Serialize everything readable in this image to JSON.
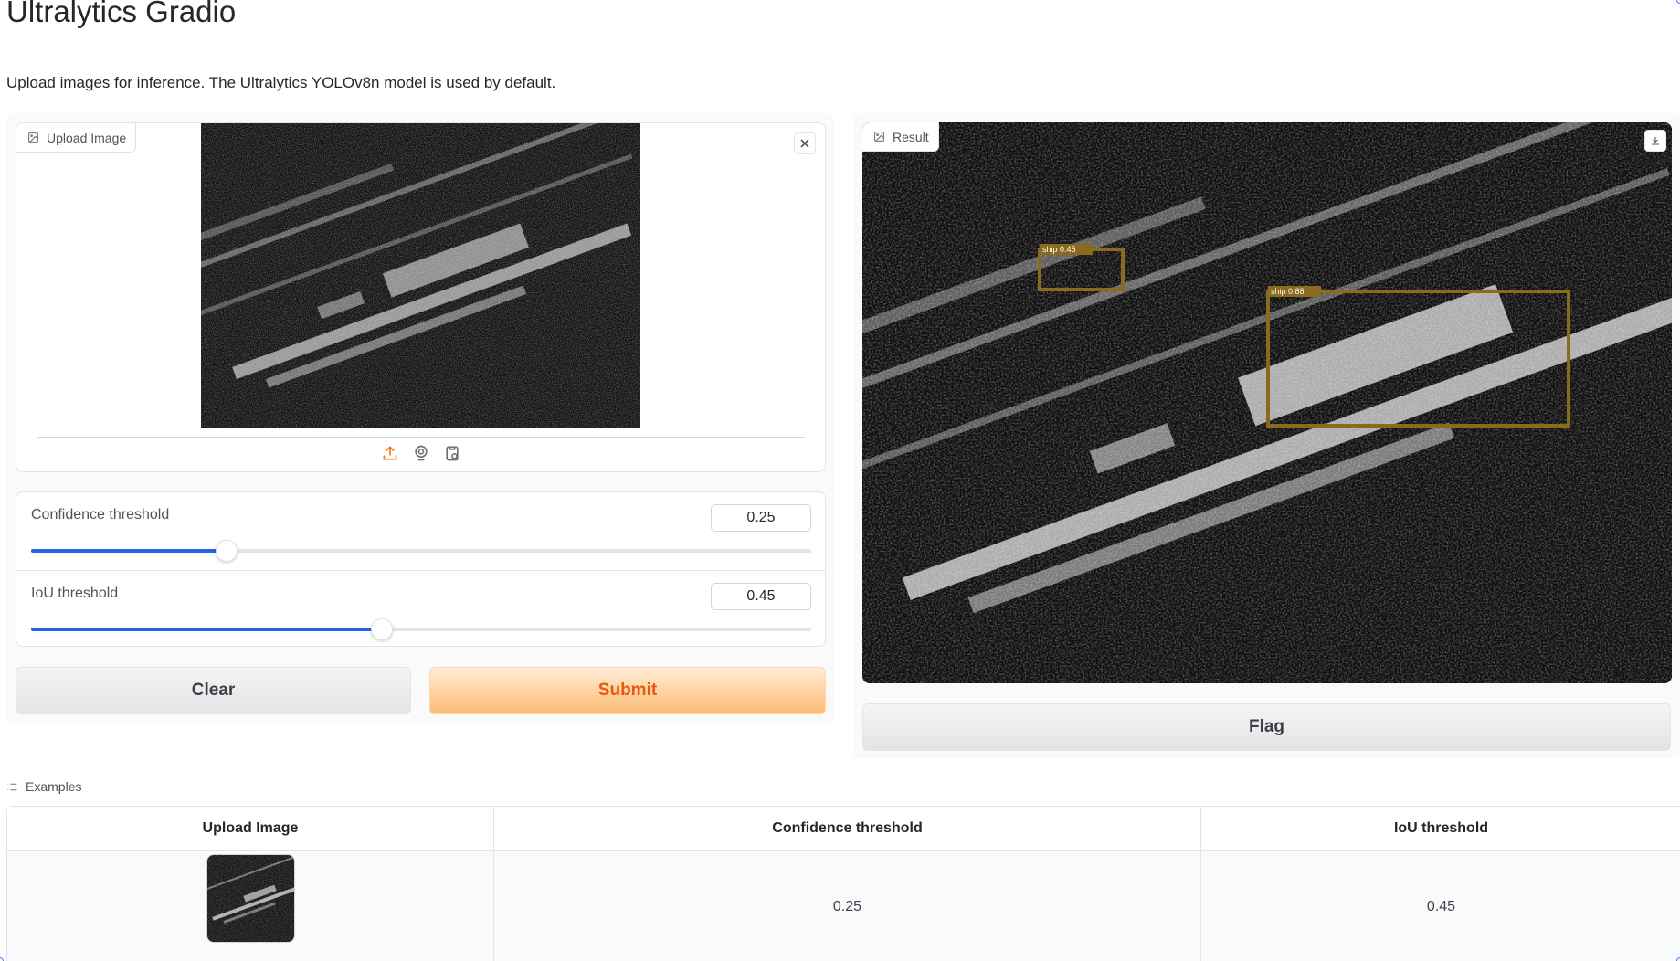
{
  "title": "Ultralytics Gradio",
  "description": "Upload images for inference. The Ultralytics YOLOv8n model is used by default.",
  "input_image": {
    "label": "Upload Image",
    "icon": "image-icon"
  },
  "source_icons": [
    "upload-icon",
    "webcam-icon",
    "clipboard-icon"
  ],
  "sliders": [
    {
      "label": "Confidence threshold",
      "value": "0.25",
      "fraction": 0.25
    },
    {
      "label": "IoU threshold",
      "value": "0.45",
      "fraction": 0.45
    }
  ],
  "buttons": {
    "clear": "Clear",
    "submit": "Submit",
    "flag": "Flag"
  },
  "result": {
    "label": "Result",
    "detections": [
      {
        "label": "ship 0.45"
      },
      {
        "label": "ship 0.88"
      }
    ],
    "box_color": "#8a6a1e"
  },
  "colors": {
    "accent": "#2563eb",
    "submit_text": "#ea580c",
    "submit_bg": "#fdba74"
  },
  "examples": {
    "label": "Examples",
    "headers": [
      "Upload Image",
      "Confidence threshold",
      "IoU threshold"
    ],
    "rows": [
      {
        "confidence": "0.25",
        "iou": "0.45"
      }
    ]
  }
}
